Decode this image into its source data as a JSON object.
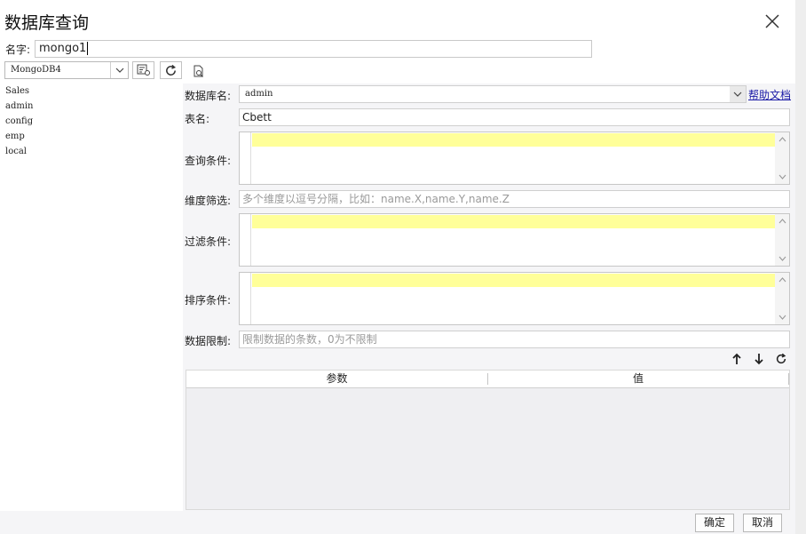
{
  "window": {
    "title": "数据库查询"
  },
  "name_row": {
    "label": "名字:",
    "value": "mongo1"
  },
  "toolbar": {
    "db_type": "MongoDB4"
  },
  "tree": {
    "items": [
      "Sales",
      "admin",
      "config",
      "emp",
      "local"
    ]
  },
  "form": {
    "db_name_label": "数据库名:",
    "db_name_value": "admin",
    "help_link": "帮助文档",
    "table_label": "表名:",
    "table_value": "Cbett",
    "query_label": "查询条件:",
    "dimension_label": "维度筛选:",
    "dimension_placeholder": "多个维度以逗号分隔，比如：name.X,name.Y,name.Z",
    "filter_label": "过滤条件:",
    "sort_label": "排序条件:",
    "limit_label": "数据限制:",
    "limit_placeholder": "限制数据的条数，0为不限制"
  },
  "params": {
    "col_param": "参数",
    "col_value": "值"
  },
  "footer": {
    "ok": "确定",
    "cancel": "取消"
  }
}
